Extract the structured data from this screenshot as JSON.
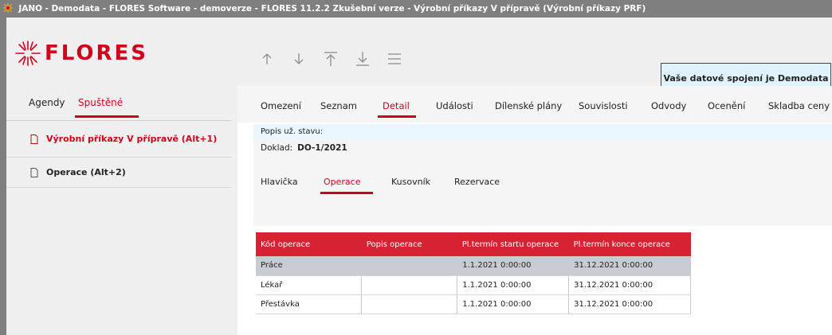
{
  "window": {
    "title_prefix": "JANO",
    "title_rest": "- Demodata - FLORES Software - demoverze - FLORES 11.2.2 Zkušební verze - Výrobní příkazy V přípravě  (Výrobní příkazy PRF)"
  },
  "logo": {
    "text": "FLORES"
  },
  "toolbar": {
    "icons": [
      "arrow-up-icon",
      "arrow-down-icon",
      "move-to-top-icon",
      "move-to-bottom-icon",
      "menu-icon"
    ]
  },
  "connection": {
    "label": "Vaše datové spojení je Demodata"
  },
  "sidebar": {
    "tabs": [
      {
        "label": "Agendy"
      },
      {
        "label": "Spuštěné"
      }
    ],
    "active_tab": "Spuštěné",
    "items": [
      {
        "label": "Výrobní příkazy V přípravě (Alt+1)",
        "active": true
      },
      {
        "label": "Operace (Alt+2)",
        "active": false
      }
    ]
  },
  "main": {
    "tabs": [
      {
        "label": "Omezení"
      },
      {
        "label": "Seznam"
      },
      {
        "label": "Detail"
      },
      {
        "label": "Události"
      },
      {
        "label": "Dílenské plány"
      },
      {
        "label": "Souvislosti"
      },
      {
        "label": "Odvody"
      },
      {
        "label": "Ocenění"
      },
      {
        "label": "Skladba ceny"
      }
    ],
    "active_tab": "Detail",
    "status_label": "Popis už. stavu:",
    "doklad_label": "Doklad:",
    "doklad_value": "DO-1/2021",
    "subtabs": [
      {
        "label": "Hlavička"
      },
      {
        "label": "Operace"
      },
      {
        "label": "Kusovník"
      },
      {
        "label": "Rezervace"
      }
    ],
    "active_subtab": "Operace",
    "table": {
      "columns": [
        "Kód operace",
        "Popis operace",
        "Pl.termín startu operace",
        "Pl.termín konce operace"
      ],
      "rows": [
        [
          "Práce",
          "",
          "1.1.2021 0:00:00",
          "31.12.2021 0:00:00"
        ],
        [
          "Lékař",
          "",
          "1.1.2021 0:00:00",
          "31.12.2021 0:00:00"
        ],
        [
          "Přestávka",
          "",
          "1.1.2021 0:00:00",
          "31.12.2021 0:00:00"
        ]
      ]
    }
  },
  "colors": {
    "accent": "#d0021b",
    "table_header": "#d62231",
    "info_bg": "#e9f6fd"
  }
}
